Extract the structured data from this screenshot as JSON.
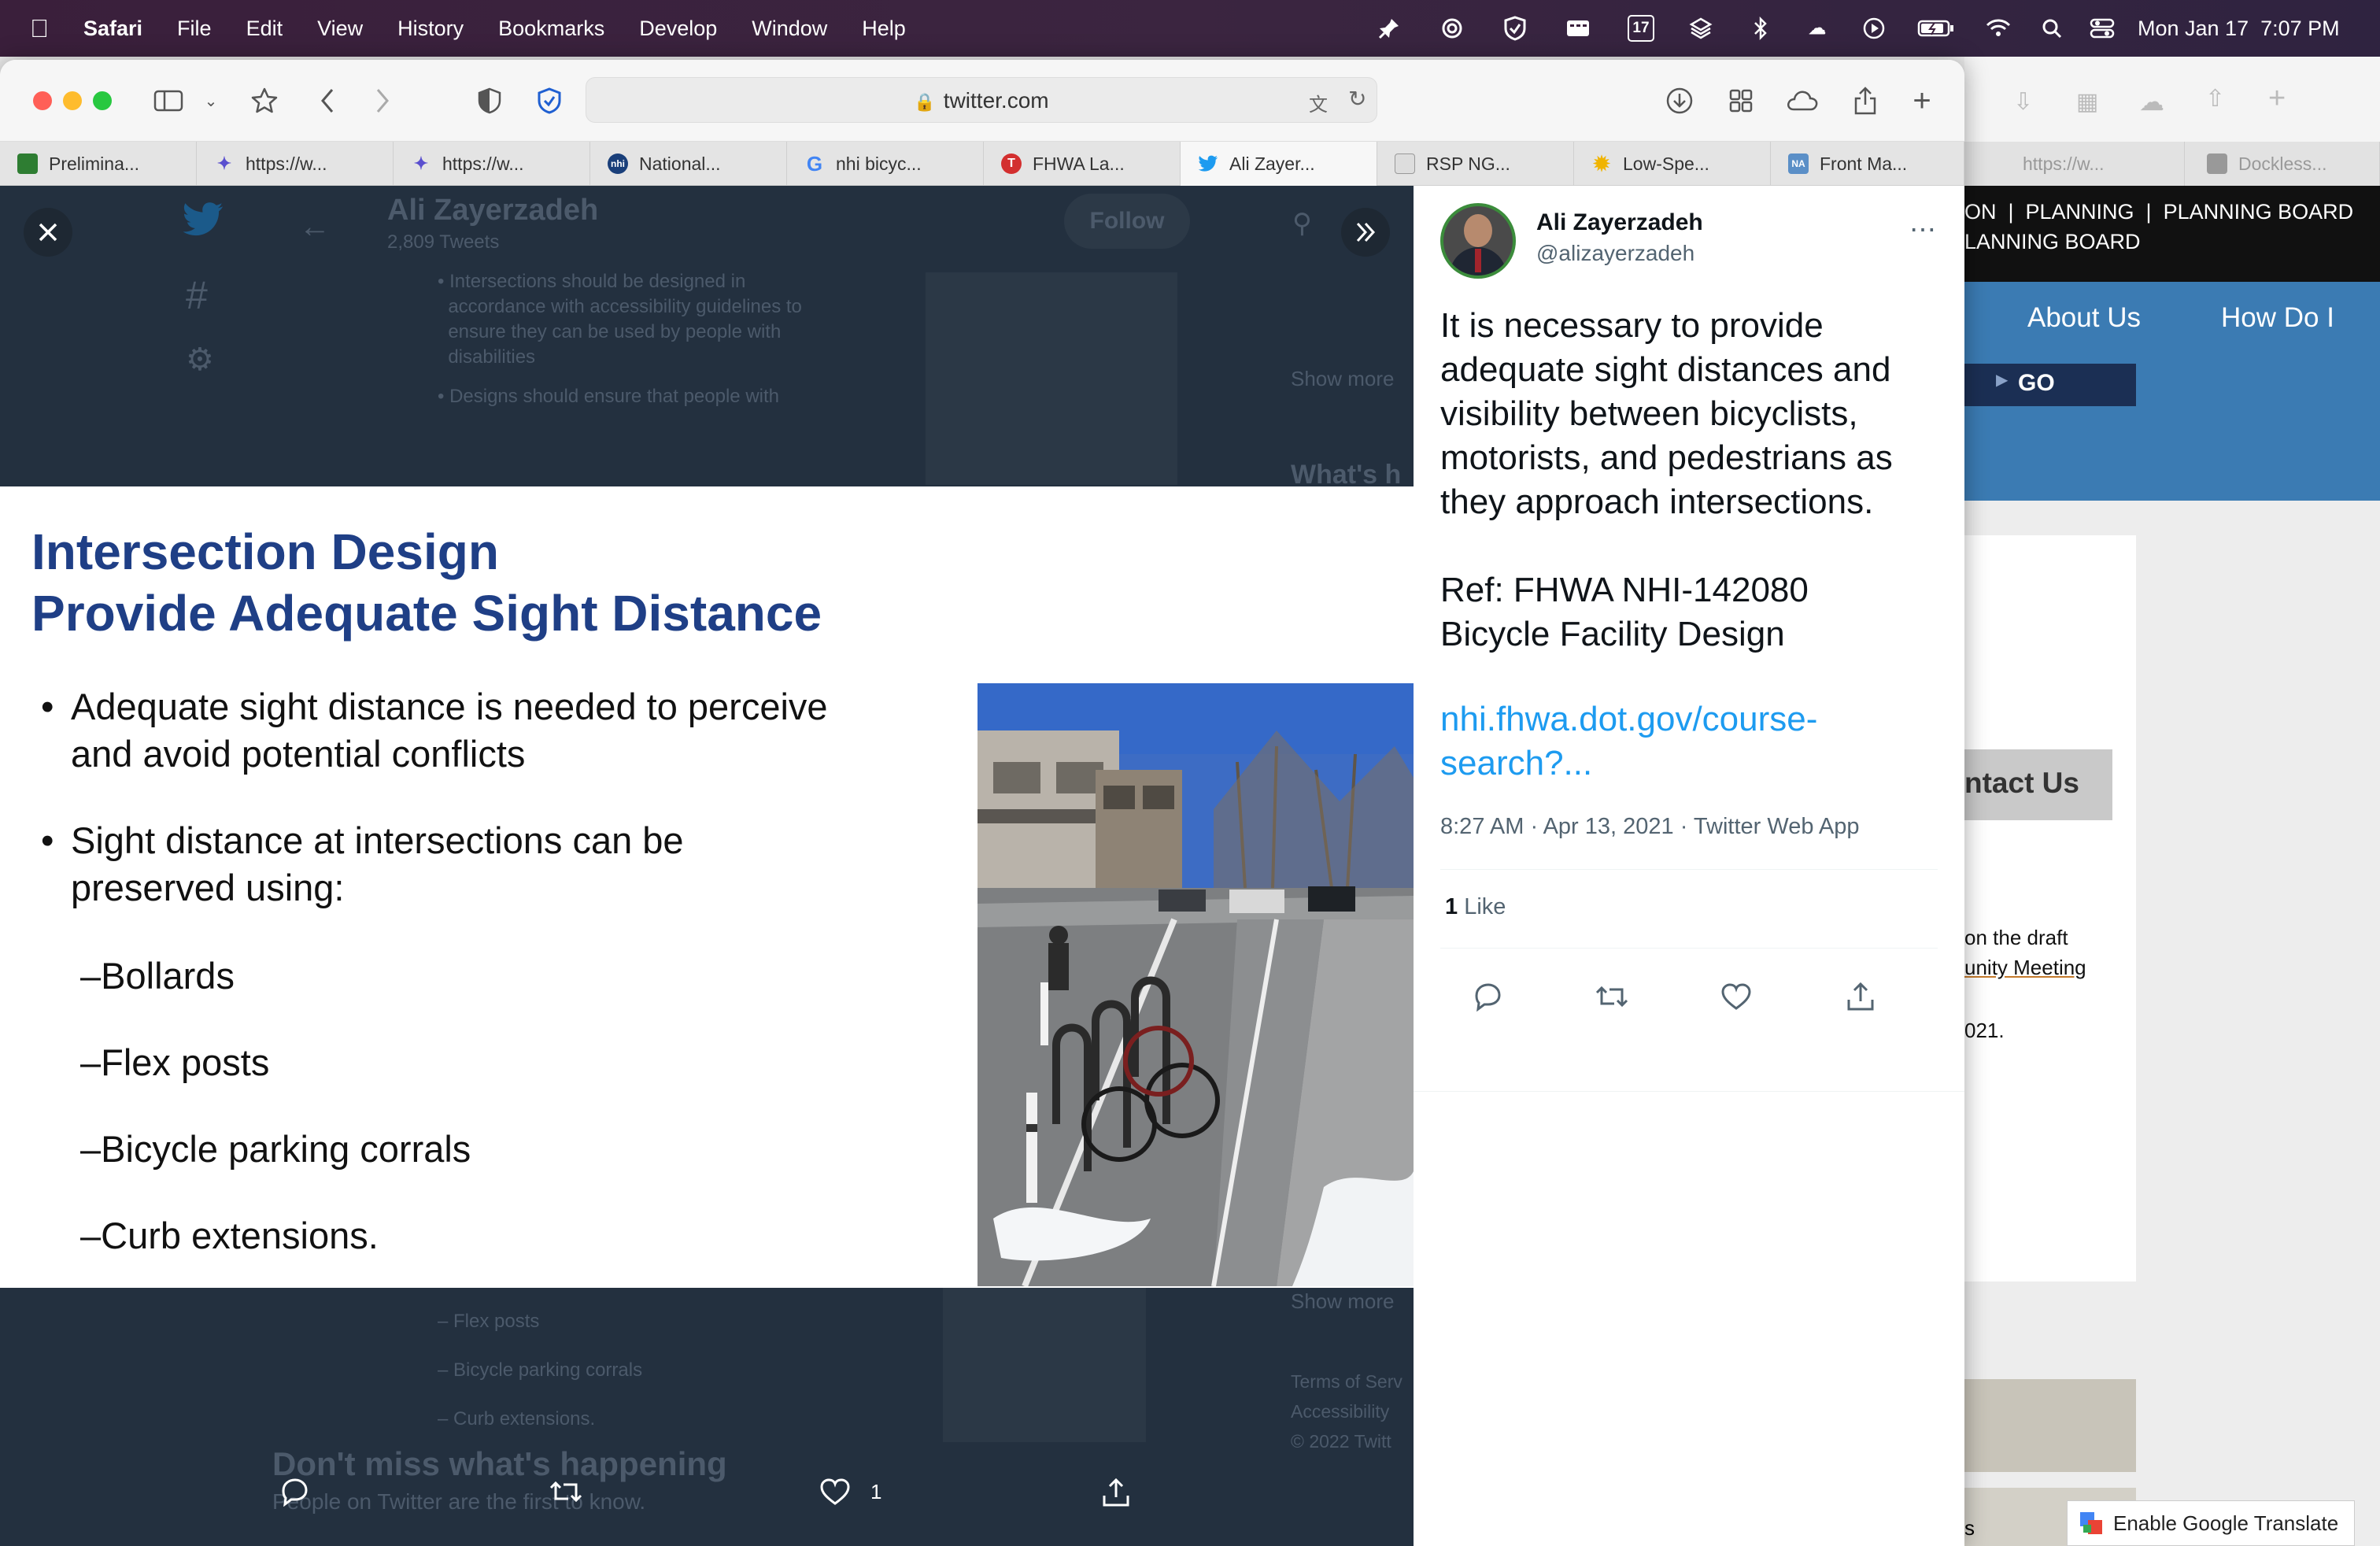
{
  "menubar": {
    "app": "Safari",
    "items": [
      "File",
      "Edit",
      "View",
      "History",
      "Bookmarks",
      "Develop",
      "Window",
      "Help"
    ],
    "calendar_day": "17",
    "clock": "Mon Jan 17  7:07 PM"
  },
  "browser": {
    "url": "twitter.com",
    "tabs": [
      {
        "label": "Prelimina...",
        "color": "#2e7d32"
      },
      {
        "label": "https://w...",
        "color": "#5a4fcf"
      },
      {
        "label": "https://w...",
        "color": "#5a4fcf"
      },
      {
        "label": "National...",
        "color": "#1a3f7a"
      },
      {
        "label": "nhi bicyc...",
        "color": "#4285f4"
      },
      {
        "label": "FHWA La...",
        "color": "#d32f2f"
      },
      {
        "label": "Ali Zayer...",
        "color": "#1d9bf0"
      },
      {
        "label": "RSP NG...",
        "color": "#777777"
      },
      {
        "label": "Low-Spe...",
        "color": "#f0b400"
      },
      {
        "label": "Front Ma...",
        "color": "#5b8fc7"
      }
    ],
    "bg_tabs": [
      {
        "label": "https://w..."
      },
      {
        "label": "Dockless..."
      }
    ]
  },
  "behind": {
    "name": "Ali Zayerzadeh",
    "tweets": "2,809 Tweets",
    "follow": "Follow",
    "lines": [
      "• Intersections should be designed in",
      "  accordance with accessibility guidelines to",
      "  ensure they can be used by people with",
      "  disabilities",
      "• Designs should ensure that people with"
    ],
    "show_more": "Show more",
    "whats": "What's h",
    "lower_lines": [
      "– Flex posts",
      "– Bicycle parking corrals",
      "– Curb extensions."
    ],
    "terms": [
      "Terms of Serv",
      "Accessibility",
      "© 2022 Twitt"
    ],
    "dont_miss": "Don't miss what's happening",
    "people": "People on Twitter are the first to know."
  },
  "slide": {
    "title_line1": "Intersection Design",
    "title_line2": "Provide Adequate Sight Distance",
    "bullet1_line1": "Adequate sight distance is needed to perceive",
    "bullet1_line2": "and avoid potential conflicts",
    "bullet2_line1": "Sight distance at intersections can be",
    "bullet2_line2": "preserved using:",
    "subitems": [
      "–Bollards",
      "–Flex posts",
      "–Bicycle parking corrals",
      "–Curb extensions."
    ]
  },
  "viewer_actions": {
    "like_count": "1"
  },
  "tweet": {
    "author_name": "Ali Zayerzadeh",
    "author_handle": "@alizayerzadeh",
    "text": "It is necessary to provide adequate sight distances and visibility between bicyclists, motorists, and pedestrians as they approach intersections.",
    "ref_line1": "Ref: FHWA NHI-142080",
    "ref_line2": "Bicycle Facility Design",
    "link_line1": "nhi.fhwa.dot.gov/course-",
    "link_line2": "search?...",
    "meta": "8:27 AM · Apr 13, 2021 · Twitter Web App",
    "likes_count": "1",
    "likes_label": "Like"
  },
  "background_page": {
    "topnav_line1": "ON  |  PLANNING  |  PLANNING BOARD",
    "topnav_line2": "LANNING BOARD",
    "nav_about": "About Us",
    "nav_how": "How Do I",
    "go": "GO",
    "contact": "ntact Us",
    "text1": "on the draft",
    "text2": "unity Meeting",
    "text3": "021.",
    "text4": "s"
  },
  "google_translate": "Enable Google Translate"
}
